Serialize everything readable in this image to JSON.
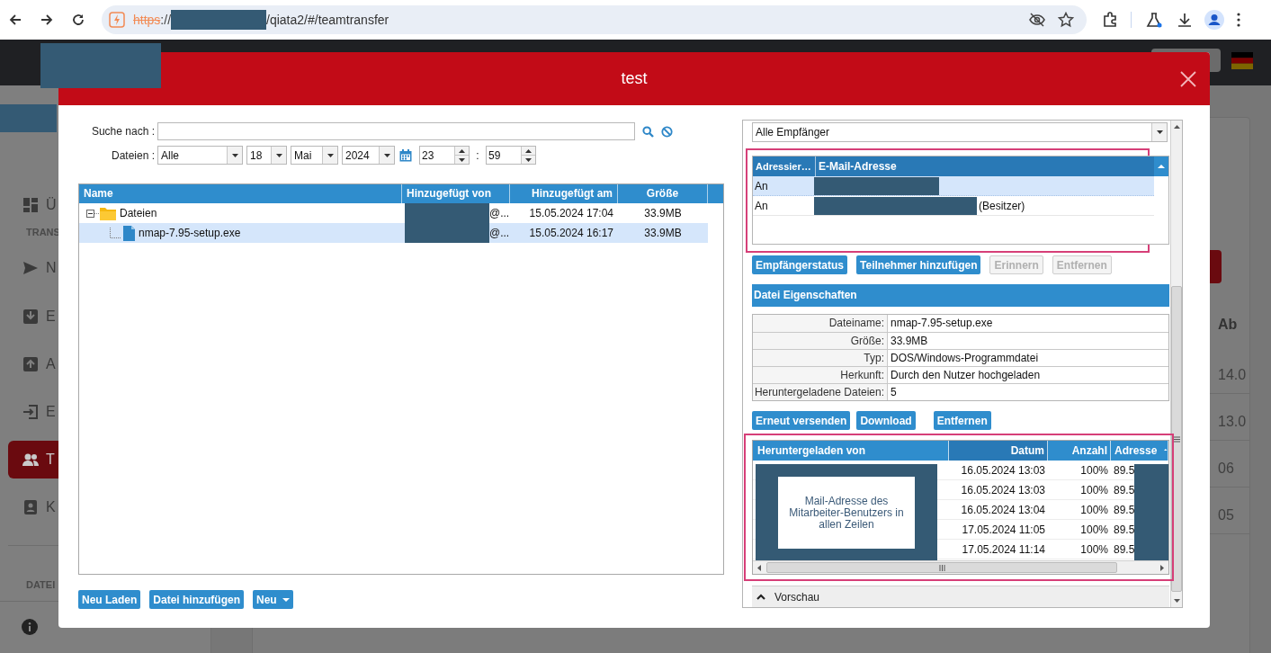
{
  "browser": {
    "url_scheme": "https",
    "url_separator": "://",
    "url_path": "/qiata2/#/teamtransfer"
  },
  "sidebar": {
    "items": [
      {
        "kind": "item",
        "label": "Ü",
        "selected": false
      },
      {
        "kind": "section",
        "label": "TRANS"
      },
      {
        "kind": "item",
        "label": "N",
        "selected": false
      },
      {
        "kind": "item",
        "label": "E",
        "selected": false
      },
      {
        "kind": "item",
        "label": "A",
        "selected": false
      },
      {
        "kind": "item",
        "label": "E",
        "selected": false
      },
      {
        "kind": "item",
        "label": "T",
        "selected": true
      },
      {
        "kind": "item",
        "label": "K",
        "selected": false
      },
      {
        "kind": "section",
        "label": "DATEI"
      }
    ]
  },
  "background_table": {
    "column_header": "Ab",
    "cells": [
      "14.0",
      "13.0",
      "06",
      "05"
    ]
  },
  "dialog": {
    "title": "test",
    "search": {
      "label": "Suche nach :"
    },
    "filter": {
      "label": "Dateien :",
      "type": "Alle",
      "day": "18",
      "month": "Mai",
      "year": "2024",
      "hour": "23",
      "separator": ":",
      "minute": "59"
    },
    "files": {
      "columns": [
        "Name",
        "Hinzugefügt von",
        "Hinzugefügt am",
        "Größe"
      ],
      "rows": [
        {
          "kind": "folder",
          "name": "Dateien",
          "expanded": true,
          "selected": false,
          "added_by": "@...",
          "added_at": "15.05.2024 17:04",
          "size": "33.9MB",
          "children": [
            {
              "kind": "file",
              "name": "nmap-7.95-setup.exe",
              "selected": true,
              "added_by": "@...",
              "added_at": "15.05.2024 16:17",
              "size": "33.9MB"
            }
          ]
        }
      ]
    },
    "file_buttons": [
      {
        "label": "Neu Laden",
        "dropdown": false
      },
      {
        "label": "Datei hinzufügen",
        "dropdown": false
      },
      {
        "label": "Neu",
        "dropdown": true
      }
    ],
    "recipient_filter": "Alle Empfänger",
    "recipients": {
      "columns": [
        "Adressier…",
        "E-Mail-Adresse"
      ],
      "rows": [
        {
          "type": "An",
          "selected": true
        },
        {
          "type": "An",
          "note": "(Besitzer)",
          "selected": false
        }
      ]
    },
    "recipient_buttons": [
      {
        "label": "Empfängerstatus",
        "disabled": false
      },
      {
        "label": "Teilnehmer hinzufügen",
        "disabled": false
      },
      {
        "label": "Erinnern",
        "disabled": true
      },
      {
        "label": "Entfernen",
        "disabled": true
      }
    ],
    "properties": {
      "title": "Datei Eigenschaften",
      "rows": [
        {
          "label": "Dateiname:",
          "value": "nmap-7.95-setup.exe"
        },
        {
          "label": "Größe:",
          "value": "33.9MB"
        },
        {
          "label": "Typ:",
          "value": "DOS/Windows-Programmdatei"
        },
        {
          "label": "Herkunft:",
          "value": "Durch den Nutzer hochgeladen"
        },
        {
          "label": "Heruntergeladene Dateien:",
          "value": "5"
        }
      ]
    },
    "file_actions": [
      {
        "label": "Erneut versenden"
      },
      {
        "label": "Download"
      },
      {
        "label": "Entfernen"
      }
    ],
    "downloads": {
      "columns": [
        {
          "label": "Heruntergeladen von",
          "sorted": false
        },
        {
          "label": "Datum",
          "sorted": true
        },
        {
          "label": "Anzahl",
          "sorted": false
        },
        {
          "label": "Adresse",
          "sorted": false
        }
      ],
      "rows": [
        {
          "date": "16.05.2024 13:03",
          "count": "100%",
          "address": "89.5"
        },
        {
          "date": "16.05.2024 13:03",
          "count": "100%",
          "address": "89.5"
        },
        {
          "date": "16.05.2024 13:04",
          "count": "100%",
          "address": "89.5"
        },
        {
          "date": "17.05.2024 11:05",
          "count": "100%",
          "address": "89.5"
        },
        {
          "date": "17.05.2024 11:14",
          "count": "100%",
          "address": "89.5"
        }
      ],
      "redaction_note": "Mail-Adresse des Mitarbeiter-Benutzers in allen Zeilen"
    },
    "preview": {
      "label": "Vorschau",
      "expanded": false
    }
  }
}
